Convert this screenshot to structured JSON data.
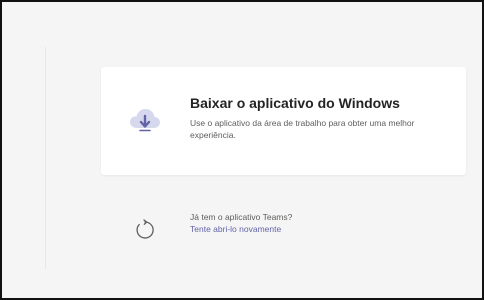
{
  "download_card": {
    "title": "Baixar o aplicativo do Windows",
    "description": "Use o aplicativo da área de trabalho para obter uma melhor experiência.",
    "icon": "cloud-download-icon"
  },
  "existing_app": {
    "question": "Já tem o aplicativo Teams?",
    "retry_link": "Tente abri-lo novamente",
    "icon": "refresh-icon"
  },
  "colors": {
    "background": "#f5f5f5",
    "card": "#ffffff",
    "title": "#252423",
    "body_text": "#605e5c",
    "link": "#6264a7",
    "icon_cloud": "#d6d8ee",
    "icon_arrow": "#6264a7",
    "icon_refresh": "#5f5f5f"
  }
}
